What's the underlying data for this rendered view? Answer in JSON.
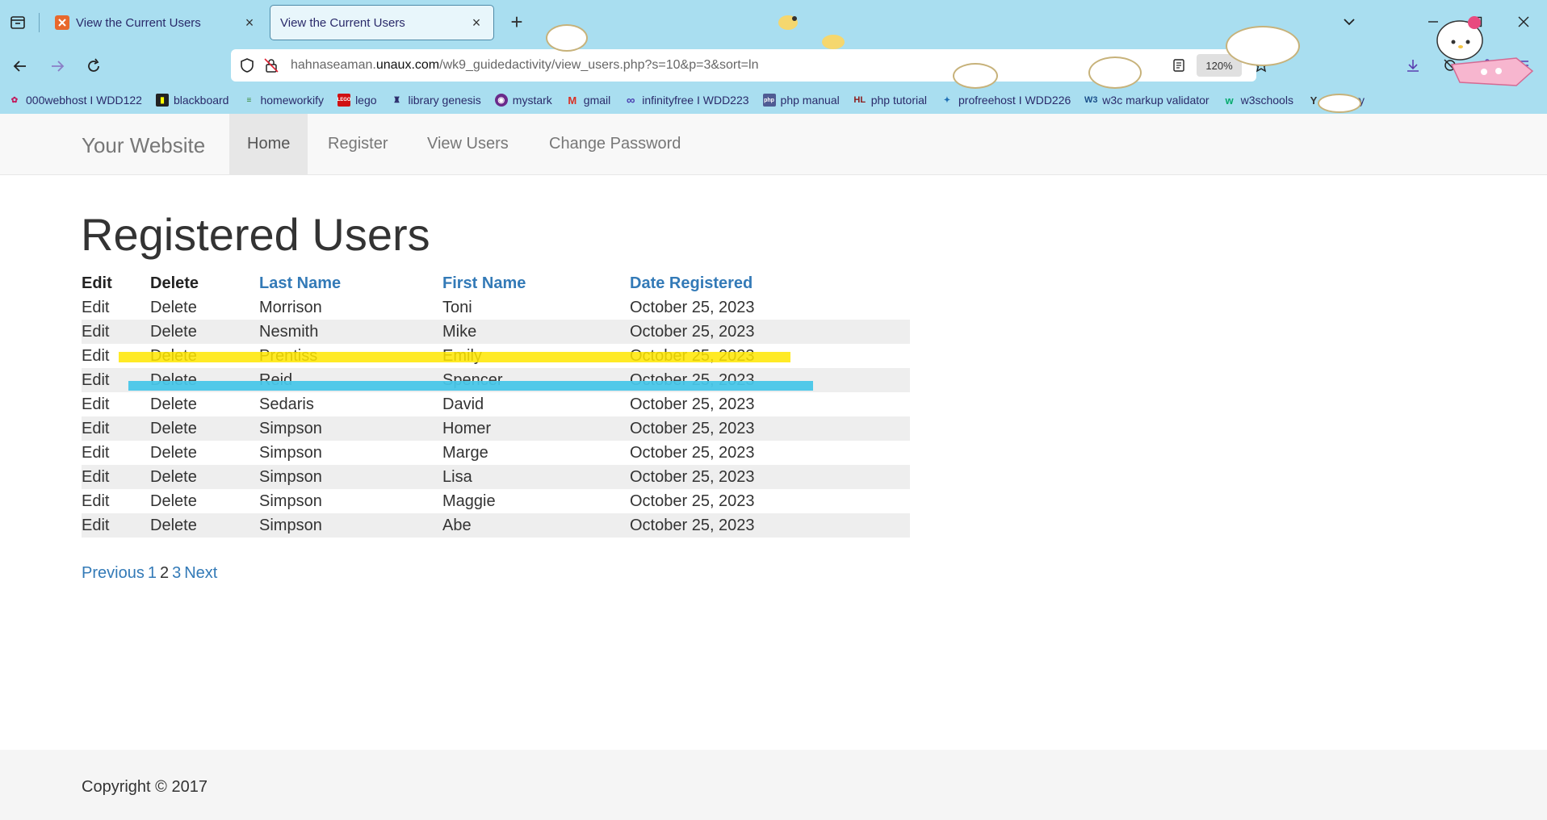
{
  "browser": {
    "tabs": [
      {
        "title": "View the Current Users",
        "active": false
      },
      {
        "title": "View the Current Users",
        "active": true
      }
    ],
    "url": {
      "prefix": "hahnaseaman.",
      "domain": "unaux.com",
      "path": "/wk9_guidedactivity/view_users.php?s=10&p=3&sort=ln"
    },
    "zoom": "120%",
    "bookmarks": [
      {
        "label": "000webhost I WDD122",
        "icon": "webhost-icon"
      },
      {
        "label": "blackboard",
        "icon": "blackboard-icon"
      },
      {
        "label": "homeworkify",
        "icon": "books-icon"
      },
      {
        "label": "lego",
        "icon": "lego-icon"
      },
      {
        "label": "library genesis",
        "icon": "library-icon"
      },
      {
        "label": "mystark",
        "icon": "mystark-icon"
      },
      {
        "label": "gmail",
        "icon": "gmail-icon"
      },
      {
        "label": "infinityfree I WDD223",
        "icon": "infinity-icon"
      },
      {
        "label": "php manual",
        "icon": "php-icon"
      },
      {
        "label": "php tutorial",
        "icon": "hl-icon"
      },
      {
        "label": "profreehost I WDD226",
        "icon": "profreehost-icon"
      },
      {
        "label": "w3c markup validator",
        "icon": "w3c-icon"
      },
      {
        "label": "w3schools",
        "icon": "w3schools-icon"
      },
      {
        "label": "z library",
        "icon": "zlibrary-icon"
      }
    ]
  },
  "site": {
    "brand": "Your Website",
    "nav": [
      "Home",
      "Register",
      "View Users",
      "Change Password"
    ],
    "active_nav": "Home"
  },
  "main": {
    "title": "Registered Users",
    "columns": {
      "edit": "Edit",
      "delete": "Delete",
      "last_name": "Last Name",
      "first_name": "First Name",
      "date": "Date Registered"
    },
    "rows": [
      {
        "edit": "Edit",
        "delete": "Delete",
        "last": "Morrison",
        "first": "Toni",
        "date": "October 25, 2023"
      },
      {
        "edit": "Edit",
        "delete": "Delete",
        "last": "Nesmith",
        "first": "Mike",
        "date": "October 25, 2023"
      },
      {
        "edit": "Edit",
        "delete": "Delete",
        "last": "Prentiss",
        "first": "Emily",
        "date": "October 25, 2023"
      },
      {
        "edit": "Edit",
        "delete": "Delete",
        "last": "Reid",
        "first": "Spencer",
        "date": "October 25, 2023"
      },
      {
        "edit": "Edit",
        "delete": "Delete",
        "last": "Sedaris",
        "first": "David",
        "date": "October 25, 2023"
      },
      {
        "edit": "Edit",
        "delete": "Delete",
        "last": "Simpson",
        "first": "Homer",
        "date": "October 25, 2023"
      },
      {
        "edit": "Edit",
        "delete": "Delete",
        "last": "Simpson",
        "first": "Marge",
        "date": "October 25, 2023"
      },
      {
        "edit": "Edit",
        "delete": "Delete",
        "last": "Simpson",
        "first": "Lisa",
        "date": "October 25, 2023"
      },
      {
        "edit": "Edit",
        "delete": "Delete",
        "last": "Simpson",
        "first": "Maggie",
        "date": "October 25, 2023"
      },
      {
        "edit": "Edit",
        "delete": "Delete",
        "last": "Simpson",
        "first": "Abe",
        "date": "October 25, 2023"
      }
    ],
    "pagination": {
      "previous": "Previous",
      "pages": [
        "1",
        "2",
        "3"
      ],
      "current": "2",
      "next": "Next"
    }
  },
  "footer": {
    "text": "Copyright © 2017"
  },
  "colors": {
    "link": "#337ab7",
    "highlight_yellow": "#ffe600",
    "highlight_blue": "#48c6e8",
    "chrome_bg": "#a9def0"
  }
}
